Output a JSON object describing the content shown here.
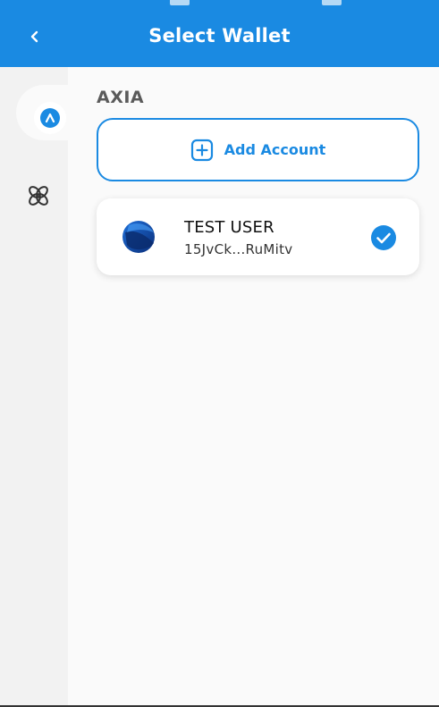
{
  "header": {
    "title": "Select Wallet",
    "back_icon": "chevron-left-icon"
  },
  "sidebar": {
    "chains": [
      {
        "name": "axia",
        "icon": "axia-logo-icon",
        "selected": true
      },
      {
        "name": "other-chain",
        "icon": "link-chain-icon",
        "selected": false
      }
    ]
  },
  "section": {
    "label": "AXIA"
  },
  "add_account": {
    "label": "Add Account",
    "icon": "plus-square-icon"
  },
  "accounts": [
    {
      "name": "TEST USER",
      "address": "15JvCk...RuMitv",
      "selected": true
    }
  ],
  "colors": {
    "accent": "#1a8ae2",
    "background": "#fafafa",
    "sidebar": "#f2f2f2"
  }
}
